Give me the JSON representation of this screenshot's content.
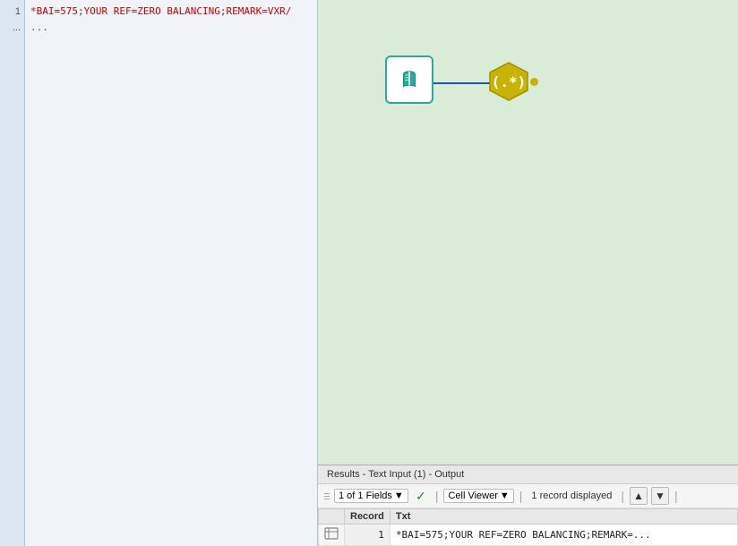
{
  "leftPanel": {
    "rows": [
      {
        "num": "1",
        "content": "*BAI=575;YOUR REF=ZERO BALANCING;REMARK=VXR/"
      },
      {
        "num": "...",
        "content": "..."
      }
    ]
  },
  "canvas": {
    "readerNodeLabel": "Text Input",
    "regexNodeLabel": "RegEx"
  },
  "resultsPanel": {
    "headerText": "Results - Text Input (1) - Output",
    "toolbar": {
      "fieldsText": "1 of 1 Fields",
      "dropdownArrow": "▼",
      "checkmark": "✓",
      "separator": "|",
      "cellViewerText": "Cell Viewer",
      "recordsText": "1 record displayed"
    },
    "table": {
      "columns": [
        "Record",
        "Txt"
      ],
      "rows": [
        {
          "num": "1",
          "txt": "*BAI=575;YOUR REF=ZERO BALANCING;REMARK=..."
        }
      ]
    }
  }
}
